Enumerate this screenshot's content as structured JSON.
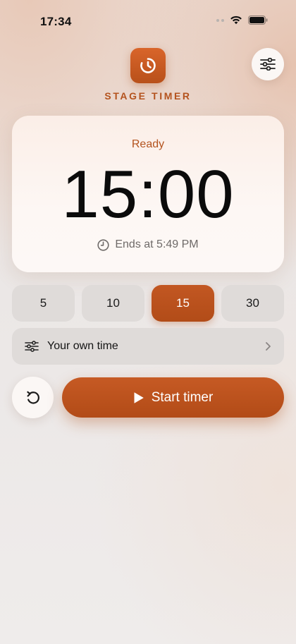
{
  "status_bar": {
    "time": "17:34"
  },
  "header": {
    "title": "STAGE TIMER"
  },
  "timer": {
    "status": "Ready",
    "display": "15:00",
    "ends_label": "Ends at 5:49 PM"
  },
  "presets": [
    {
      "label": "5",
      "active": false
    },
    {
      "label": "10",
      "active": false
    },
    {
      "label": "15",
      "active": true
    },
    {
      "label": "30",
      "active": false
    }
  ],
  "custom_time": {
    "label": "Your own time"
  },
  "actions": {
    "start_label": "Start timer"
  },
  "colors": {
    "accent": "#b8501a",
    "accent_text": "#b4531e",
    "chip_bg": "#dfdbd9"
  },
  "icons": {
    "logo": "timer-icon",
    "settings": "sliders-icon",
    "clock": "clock-icon",
    "custom": "sliders-icon",
    "chevron": "chevron-right-icon",
    "reset": "reset-icon",
    "play": "play-icon"
  }
}
